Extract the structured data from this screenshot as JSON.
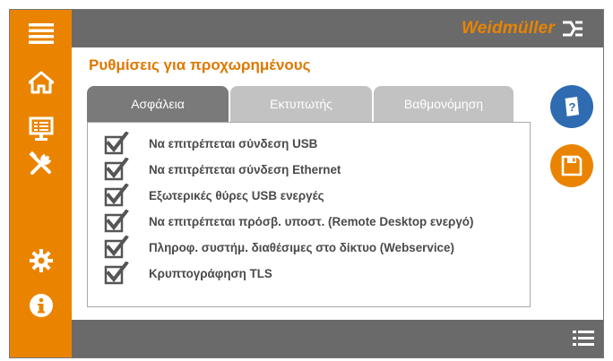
{
  "brand": {
    "name": "Weidmüller"
  },
  "page": {
    "title": "Ρυθμίσεις για προχωρημένους"
  },
  "tabs": [
    {
      "label": "Ασφάλεια",
      "active": true
    },
    {
      "label": "Εκτυπωτής",
      "active": false
    },
    {
      "label": "Βαθμονόμηση",
      "active": false
    }
  ],
  "options": [
    {
      "label": "Να επιτρέπεται σύνδεση USB",
      "checked": true
    },
    {
      "label": "Να επιτρέπεται σύνδεση Ethernet",
      "checked": true
    },
    {
      "label": "Εξωτερικές θύρες USB ενεργές",
      "checked": true
    },
    {
      "label": "Να επιτρέπεται πρόσβ. υποστ. (Remote Desktop ενεργό)",
      "checked": true
    },
    {
      "label": "Πληροφ. συστήμ. διαθέσιμες στο δίκτυο (Webservice)",
      "checked": true
    },
    {
      "label": "Κρυπτογράφηση TLS",
      "checked": true
    }
  ],
  "sidebar": {
    "icons": [
      "menu-icon",
      "home-icon",
      "monitor-icon",
      "tools-icon",
      "settings-icon",
      "info-icon"
    ]
  },
  "actions": {
    "help_icon": "help-book-icon",
    "save_icon": "save-icon",
    "list_icon": "list-icon"
  },
  "colors": {
    "accent": "#ea8400",
    "bar": "#6a6a6a",
    "help_button": "#2e6bb0",
    "save_button": "#ea8400",
    "tab_active": "#7a7a7a",
    "tab_inactive": "#c2c2c2"
  }
}
